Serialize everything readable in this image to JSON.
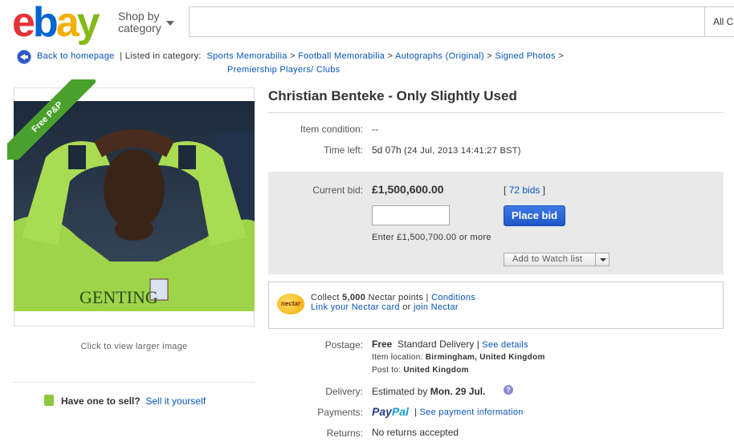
{
  "header": {
    "logo_letters": [
      "e",
      "b",
      "a",
      "y"
    ],
    "logo_colors": [
      "#e53238",
      "#0064d2",
      "#f5af02",
      "#86b817"
    ],
    "shop_by_line1": "Shop by",
    "shop_by_line2": "category",
    "search_placeholder": "",
    "all_categories": "All C"
  },
  "breadcrumb": {
    "back_label": "Back to homepage",
    "listed_in": "| Listed in category:",
    "items": [
      "Sports Memorabilia",
      "Football Memorabilia",
      "Autographs (Original)",
      "Signed Photos",
      "Premiership Players/ Clubs"
    ],
    "separator": ">"
  },
  "gallery": {
    "ribbon_text": "Free P&P",
    "click_to_view": "Click to view larger image",
    "sell_question": "Have one to sell?",
    "sell_link": "Sell it yourself",
    "shirt_text": "GENTING"
  },
  "listing": {
    "title": "Christian Benteke - Only Slightly Used",
    "condition_label": "Item condition:",
    "condition_value": "--",
    "time_left_label": "Time left:",
    "time_left_value": "5d 07h",
    "time_left_detail": "(24 Jul, 2013  14:41:27 BST)",
    "current_bid_label": "Current bid:",
    "current_bid_value": "£1,500,600.00",
    "bids_open": "[",
    "bids_link": "72 bids",
    "bids_close": "]",
    "bid_input_value": "",
    "enter_hint": "Enter £1,500,700.00 or more",
    "place_bid": "Place bid",
    "watch_list": "Add to Watch list"
  },
  "nectar": {
    "icon_text": "nectar",
    "collect_prefix": "Collect",
    "points": "5,000",
    "points_suffix": "Nectar points |",
    "conditions": "Conditions",
    "link_card": "Link your Nectar card",
    "or": "or",
    "join": "join Nectar"
  },
  "shipping": {
    "postage_label": "Postage:",
    "postage_free": "Free",
    "postage_service": "Standard Delivery |",
    "see_details": "See details",
    "item_location_label": "Item location:",
    "item_location_value": "Birmingham, United Kingdom",
    "post_to_label": "Post to:",
    "post_to_value": "United Kingdom",
    "delivery_label": "Delivery:",
    "delivery_prefix": "Estimated by",
    "delivery_date": "Mon. 29 Jul.",
    "payments_label": "Payments:",
    "paypal_pay": "Pay",
    "paypal_pal": "Pal",
    "payment_sep": "|",
    "payment_link": "See payment information",
    "returns_label": "Returns:",
    "returns_value": "No returns accepted"
  }
}
